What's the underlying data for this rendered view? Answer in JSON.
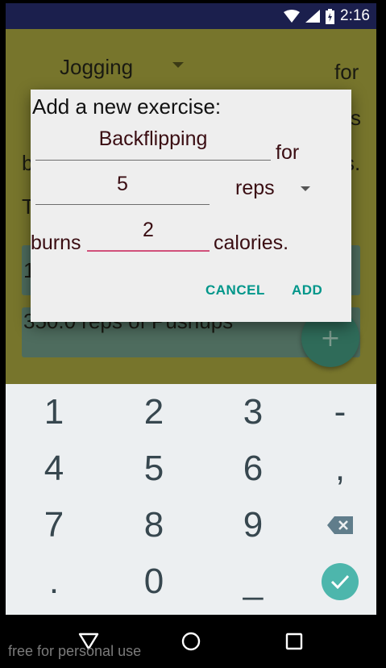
{
  "status_bar": {
    "time": "2:16",
    "icons": [
      "wifi-icon",
      "signal-icon",
      "battery-charging-icon"
    ]
  },
  "background": {
    "spinner_value": "Jogging",
    "for_label": "for",
    "text_s": "s",
    "text_b": "b",
    "text_s_dot": "s.",
    "text_T": "T",
    "text_1": "1",
    "list_item_2": "350.0 reps of Pushups",
    "fab_label": "+"
  },
  "dialog": {
    "title": "Add a new exercise:",
    "exercise_name": "Backflipping",
    "for_label": "for",
    "quantity": "5",
    "unit": "reps",
    "burns_label": "burns",
    "calories_value": "2",
    "calories_label": "calories.",
    "cancel_label": "CANCEL",
    "add_label": "ADD"
  },
  "keyboard": {
    "keys": [
      "1",
      "2",
      "3",
      "-",
      "4",
      "5",
      "6",
      ",",
      "7",
      "8",
      "9",
      ".",
      "0",
      "_"
    ]
  },
  "watermark": "free for personal use",
  "colors": {
    "accent": "#00968a",
    "field_active": "#d1507a",
    "enter_key": "#4db6ac",
    "status_bar": "#1b1f4d"
  }
}
